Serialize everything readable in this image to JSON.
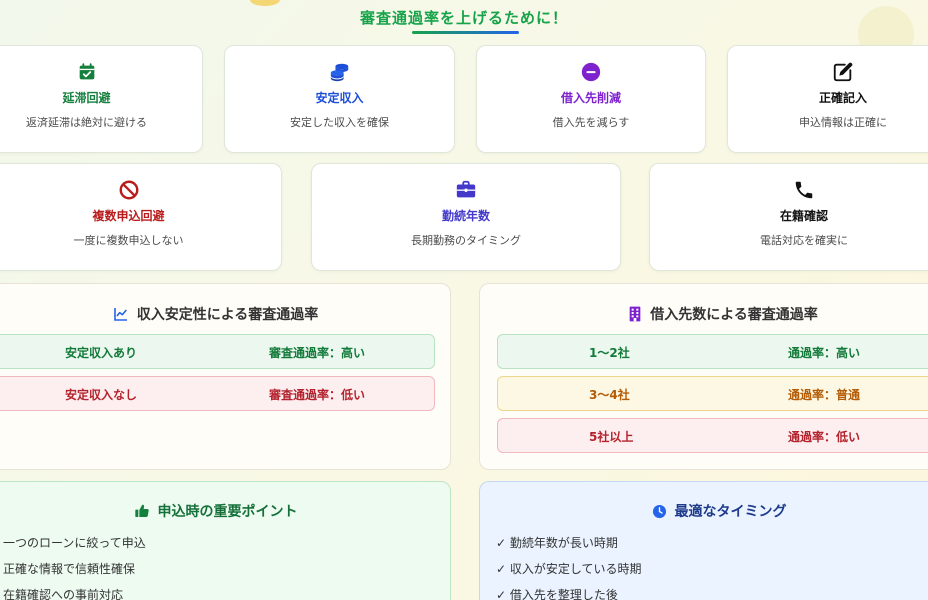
{
  "header": {
    "title": "審査通過率を上げるために！"
  },
  "tips_row1": [
    {
      "title": "延滞回避",
      "desc": "返済延滞は絶対に避ける",
      "icon": "calendar-check-icon",
      "color": "#15803d"
    },
    {
      "title": "安定収入",
      "desc": "安定した収入を確保",
      "icon": "coins-icon",
      "color": "#1d4ed8"
    },
    {
      "title": "借入先削減",
      "desc": "借入先を減らす",
      "icon": "minus-circle-icon",
      "color": "#7e22ce"
    },
    {
      "title": "正確記入",
      "desc": "申込情報は正確に",
      "icon": "edit-icon",
      "color": "#111111"
    }
  ],
  "tips_row2": [
    {
      "title": "複数申込回避",
      "desc": "一度に複数申込しない",
      "icon": "ban-icon",
      "color": "#b91c1c"
    },
    {
      "title": "勤続年数",
      "desc": "長期勤務のタイミング",
      "icon": "briefcase-icon",
      "color": "#4338ca"
    },
    {
      "title": "在籍確認",
      "desc": "電話対応を確実に",
      "icon": "phone-icon",
      "color": "#111111"
    }
  ],
  "income_panel": {
    "title": "収入安定性による審査通過率",
    "icon": "chart-line-icon",
    "rows": [
      {
        "label": "安定収入あり",
        "value": "審査通過率：高い",
        "status": "green"
      },
      {
        "label": "安定収入なし",
        "value": "審査通過率：低い",
        "status": "red"
      }
    ]
  },
  "lenders_panel": {
    "title": "借入先数による審査通過率",
    "icon": "building-icon",
    "rows": [
      {
        "label": "1〜2社",
        "value": "通過率：高い",
        "status": "green"
      },
      {
        "label": "3〜4社",
        "value": "通過率：普通",
        "status": "yellow"
      },
      {
        "label": "5社以上",
        "value": "通過率：低い",
        "status": "red"
      }
    ]
  },
  "points_panel": {
    "title": "申込時の重要ポイント",
    "icon": "thumbs-up-icon",
    "items": [
      "一つのローンに絞って申込",
      "正確な情報で信頼性確保",
      "在籍確認への事前対応"
    ]
  },
  "timing_panel": {
    "title": "最適なタイミング",
    "icon": "clock-icon",
    "items": [
      "✓ 勤続年数が長い時期",
      "✓ 収入が安定している時期",
      "✓ 借入先を整理した後"
    ]
  },
  "colors": {
    "accent_green": "#16a34a",
    "accent_blue": "#2563eb"
  }
}
